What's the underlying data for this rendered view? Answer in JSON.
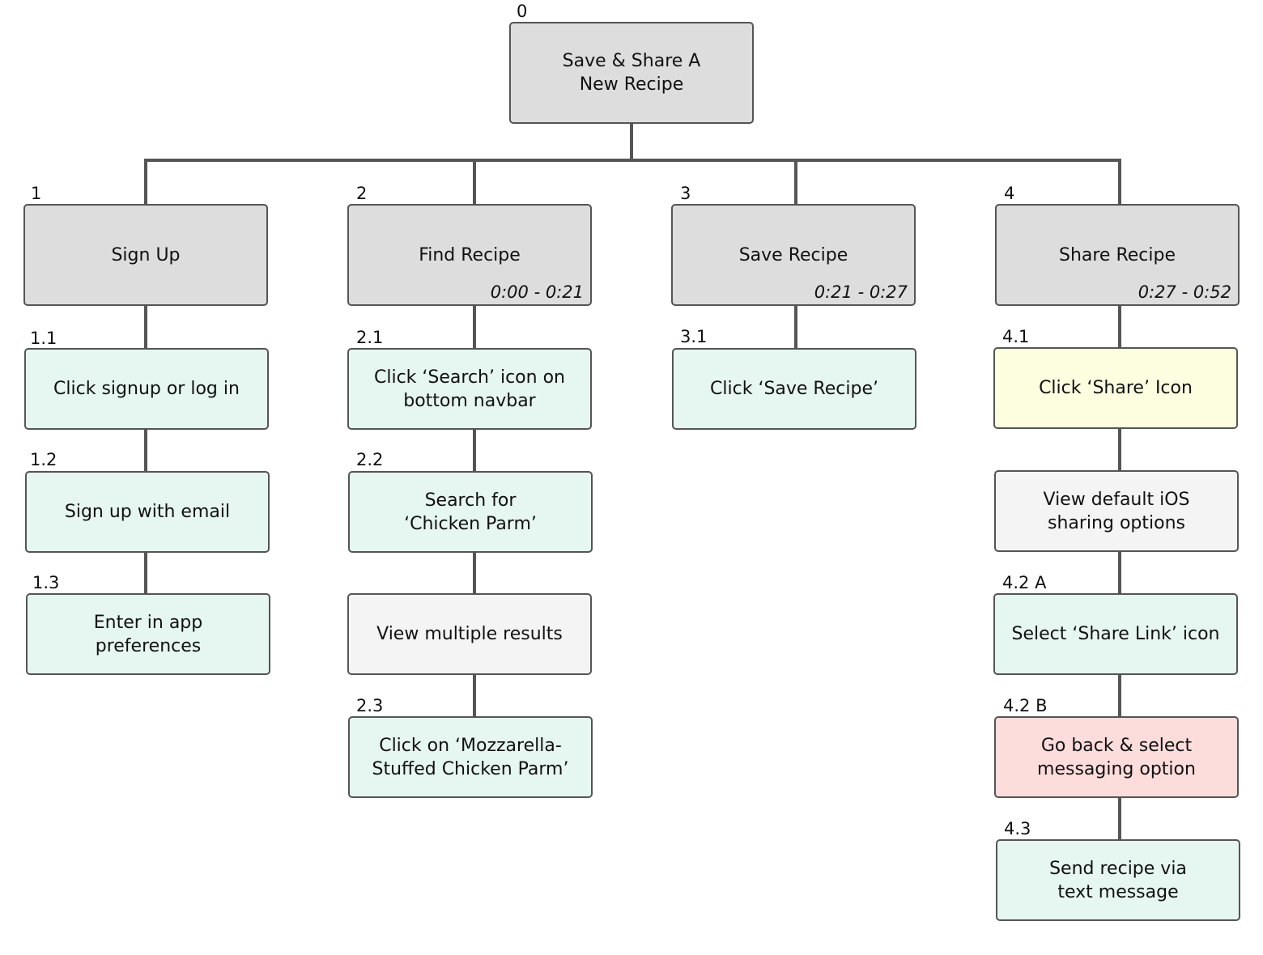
{
  "root": {
    "number": "0",
    "label": "Save & Share A\nNew Recipe"
  },
  "branches": [
    {
      "number": "1",
      "label": "Sign Up",
      "time": "",
      "steps": [
        {
          "number": "1.1",
          "label": "Click signup or log in",
          "status": "normal"
        },
        {
          "number": "1.2",
          "label": "Sign up with email",
          "status": "normal"
        },
        {
          "number": "1.3",
          "label": "Enter in app\npreferences",
          "status": "normal"
        }
      ]
    },
    {
      "number": "2",
      "label": "Find Recipe",
      "time": "0:00 - 0:21",
      "steps": [
        {
          "number": "2.1",
          "label": "Click ‘Search’ icon on\nbottom navbar",
          "status": "normal"
        },
        {
          "number": "2.2",
          "label": "Search for\n‘Chicken Parm’",
          "status": "normal"
        },
        {
          "number": "",
          "label": "View multiple results",
          "status": "system"
        },
        {
          "number": "2.3",
          "label": "Click on ‘Mozzarella-\nStuffed Chicken Parm’",
          "status": "normal"
        }
      ]
    },
    {
      "number": "3",
      "label": "Save Recipe",
      "time": "0:21 - 0:27",
      "steps": [
        {
          "number": "3.1",
          "label": "Click ‘Save Recipe’",
          "status": "normal"
        }
      ]
    },
    {
      "number": "4",
      "label": "Share Recipe",
      "time": "0:27 - 0:52",
      "steps": [
        {
          "number": "4.1",
          "label": "Click ‘Share’ Icon",
          "status": "warning"
        },
        {
          "number": "",
          "label": "View default iOS\nsharing options",
          "status": "system"
        },
        {
          "number": "4.2 A",
          "label": "Select ‘Share Link’ icon",
          "status": "normal"
        },
        {
          "number": "4.2 B",
          "label": "Go back & select\nmessaging option",
          "status": "error"
        },
        {
          "number": "4.3",
          "label": "Send recipe via\ntext message",
          "status": "normal"
        }
      ]
    }
  ],
  "colors": {
    "header": "#dddddd",
    "normal": "#e6f6f1",
    "system": "#f4f4f4",
    "warning": "#fdfde0",
    "error": "#fddcdc",
    "connector": "#555555"
  }
}
